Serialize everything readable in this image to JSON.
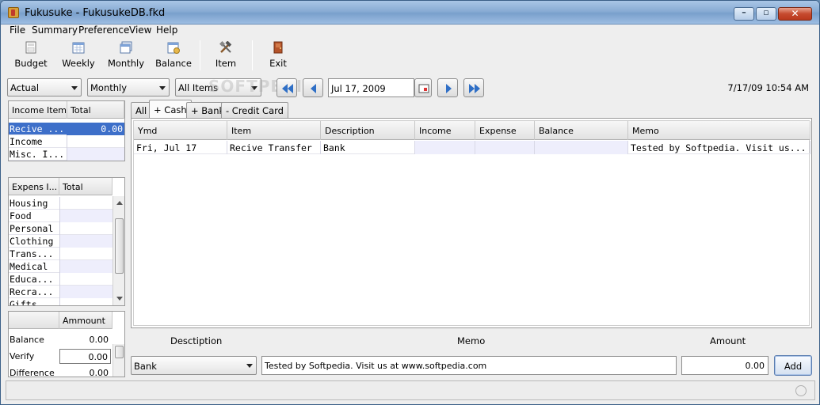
{
  "window": {
    "title": "Fukusuke - FukusukeDB.fkd"
  },
  "menu": [
    "File",
    "Summary",
    "Preference",
    "View",
    "Help"
  ],
  "toolbar": {
    "budget": "Budget",
    "weekly": "Weekly",
    "monthly": "Monthly",
    "balance": "Balance",
    "item": "Item",
    "exit": "Exit"
  },
  "nav": {
    "mode": "Actual",
    "period": "Monthly",
    "filter": "All Items",
    "date": "Jul 17, 2009",
    "clock": "7/17/09 10:54 AM",
    "watermark": "SOFTPEDIA"
  },
  "income_table": {
    "headers": [
      "Income Item",
      "Total"
    ],
    "rows": [
      {
        "item": "Recive ...",
        "total": "0.00"
      },
      {
        "item": "Income",
        "total": ""
      },
      {
        "item": "Misc. I...",
        "total": ""
      }
    ]
  },
  "expense_table": {
    "headers": [
      "Expens I...",
      "Total"
    ],
    "rows": [
      {
        "item": "Housing",
        "total": ""
      },
      {
        "item": "Food",
        "total": ""
      },
      {
        "item": "Personal",
        "total": ""
      },
      {
        "item": "Clothing",
        "total": ""
      },
      {
        "item": "Trans...",
        "total": ""
      },
      {
        "item": "Medical",
        "total": ""
      },
      {
        "item": "Educa...",
        "total": ""
      },
      {
        "item": "Recra...",
        "total": ""
      },
      {
        "item": "Gifts",
        "total": ""
      }
    ]
  },
  "summary": {
    "header": "Ammount",
    "rows": [
      {
        "label": "Balance",
        "value": "0.00"
      },
      {
        "label": "Verify",
        "value": "0.00"
      },
      {
        "label": "Difference",
        "value": "0.00"
      }
    ]
  },
  "tabs": [
    "All",
    "+ Cash",
    "+ Bank",
    "- Credit Card"
  ],
  "active_tab": "+ Cash",
  "main_table": {
    "headers": [
      "Ymd",
      "Item",
      "Description",
      "Income",
      "Expense",
      "Balance",
      "Memo"
    ],
    "rows": [
      {
        "ymd": "Fri, Jul 17",
        "item": "Recive Transfer",
        "description": "Bank",
        "income": "",
        "expense": "",
        "balance": "",
        "memo": "Tested by Softpedia. Visit us..."
      }
    ]
  },
  "entry": {
    "description_label": "Desctiption",
    "memo_label": "Memo",
    "amount_label": "Amount",
    "description_value": "Bank",
    "memo_value": "Tested by Softpedia. Visit us at www.softpedia.com",
    "amount_value": "0.00",
    "add_label": "Add"
  }
}
